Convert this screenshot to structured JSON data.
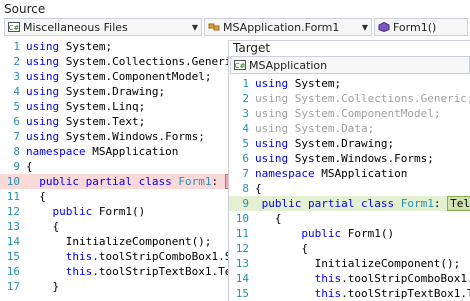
{
  "source": {
    "title": "Source",
    "combo1": {
      "value": "Miscellaneous Files",
      "icon": "csharp-file-icon"
    },
    "combo2": {
      "value": "MSApplication.Form1",
      "icon": "class-icon"
    },
    "combo3": {
      "value": "Form1()",
      "icon": "method-icon"
    },
    "lines": [
      {
        "n": "1",
        "parts": [
          [
            "kw",
            "using"
          ],
          [
            "plain",
            " System;"
          ]
        ]
      },
      {
        "n": "2",
        "parts": [
          [
            "kw",
            "using"
          ],
          [
            "plain",
            " System.Collections.Generic;"
          ]
        ]
      },
      {
        "n": "3",
        "parts": [
          [
            "kw",
            "using"
          ],
          [
            "plain",
            " System.ComponentModel;"
          ]
        ]
      },
      {
        "n": "4",
        "parts": [
          [
            "kw",
            "using"
          ],
          [
            "plain",
            " System.Drawing;"
          ]
        ]
      },
      {
        "n": "5",
        "parts": [
          [
            "kw",
            "using"
          ],
          [
            "plain",
            " System.Linq;"
          ]
        ]
      },
      {
        "n": "6",
        "parts": [
          [
            "kw",
            "using"
          ],
          [
            "plain",
            " System.Text;"
          ]
        ]
      },
      {
        "n": "7",
        "parts": [
          [
            "kw",
            "using"
          ],
          [
            "plain",
            " System.Windows.Forms;"
          ]
        ]
      },
      {
        "n": "8",
        "parts": [
          [
            "kw",
            "namespace"
          ],
          [
            "plain",
            " MSApplication"
          ]
        ]
      },
      {
        "n": "9",
        "parts": [
          [
            "plain",
            "{"
          ]
        ]
      },
      {
        "n": "10",
        "hl": "hl-src",
        "parts": [
          [
            "plain",
            "  "
          ],
          [
            "kw",
            "public partial class "
          ],
          [
            "ty",
            "Form1"
          ],
          [
            "plain",
            ": "
          ],
          [
            "chip-src",
            "Form"
          ]
        ]
      },
      {
        "n": "11",
        "parts": [
          [
            "plain",
            "  {"
          ]
        ]
      },
      {
        "n": "12",
        "parts": [
          [
            "plain",
            "    "
          ],
          [
            "kw",
            "public"
          ],
          [
            "plain",
            " Form1()"
          ]
        ]
      },
      {
        "n": "13",
        "parts": [
          [
            "plain",
            "    {"
          ]
        ]
      },
      {
        "n": "14",
        "parts": [
          [
            "plain",
            "      InitializeComponent();"
          ]
        ]
      },
      {
        "n": "15",
        "parts": [
          [
            "plain",
            "      "
          ],
          [
            "kw",
            "this"
          ],
          [
            "plain",
            ".toolStripComboBox1.Se"
          ]
        ]
      },
      {
        "n": "16",
        "parts": [
          [
            "plain",
            "      "
          ],
          [
            "kw",
            "this"
          ],
          [
            "plain",
            ".toolStripTextBox1.Te"
          ]
        ]
      },
      {
        "n": "17",
        "parts": [
          [
            "plain",
            "    }"
          ]
        ]
      }
    ]
  },
  "target": {
    "title": "Target",
    "combo": {
      "value": "MSApplication",
      "icon": "csharp-file-icon"
    },
    "lines": [
      {
        "n": "1",
        "parts": [
          [
            "kw",
            "using"
          ],
          [
            "plain",
            " System;"
          ]
        ]
      },
      {
        "n": "2",
        "gray": true,
        "parts": [
          [
            "kw",
            "using"
          ],
          [
            "plain",
            " System.Collections.Generic;"
          ]
        ]
      },
      {
        "n": "3",
        "gray": true,
        "parts": [
          [
            "kw",
            "using"
          ],
          [
            "plain",
            " System.ComponentModel;"
          ]
        ]
      },
      {
        "n": "4",
        "gray": true,
        "parts": [
          [
            "kw",
            "using"
          ],
          [
            "plain",
            " System.Data;"
          ]
        ]
      },
      {
        "n": "5",
        "parts": [
          [
            "kw",
            "using"
          ],
          [
            "plain",
            " System.Drawing;"
          ]
        ]
      },
      {
        "n": "6",
        "parts": [
          [
            "kw",
            "using"
          ],
          [
            "plain",
            " System.Windows.Forms;"
          ]
        ]
      },
      {
        "n": "7",
        "parts": [
          [
            "kw",
            "namespace"
          ],
          [
            "plain",
            " MSApplication"
          ]
        ]
      },
      {
        "n": "8",
        "parts": [
          [
            "plain",
            "{"
          ]
        ]
      },
      {
        "n": "9",
        "hl": "hl-tgt",
        "parts": [
          [
            "plain",
            " "
          ],
          [
            "kw",
            "public partial class "
          ],
          [
            "ty",
            "Form1"
          ],
          [
            "plain",
            ": "
          ],
          [
            "chip-tgt",
            "Telerik."
          ]
        ]
      },
      {
        "n": "10",
        "parts": [
          [
            "plain",
            "   {"
          ]
        ]
      },
      {
        "n": "11",
        "parts": [
          [
            "plain",
            "       "
          ],
          [
            "kw",
            "public"
          ],
          [
            "plain",
            " Form1()"
          ]
        ]
      },
      {
        "n": "12",
        "parts": [
          [
            "plain",
            "       {"
          ]
        ]
      },
      {
        "n": "13",
        "parts": [
          [
            "plain",
            "         InitializeComponent();"
          ]
        ]
      },
      {
        "n": "14",
        "parts": [
          [
            "plain",
            "         "
          ],
          [
            "kw",
            "this"
          ],
          [
            "plain",
            ".toolStripComboBox1.Se"
          ]
        ]
      },
      {
        "n": "15",
        "parts": [
          [
            "plain",
            "         "
          ],
          [
            "kw",
            "this"
          ],
          [
            "plain",
            ".toolStripTextBox1.Te"
          ]
        ]
      }
    ]
  }
}
